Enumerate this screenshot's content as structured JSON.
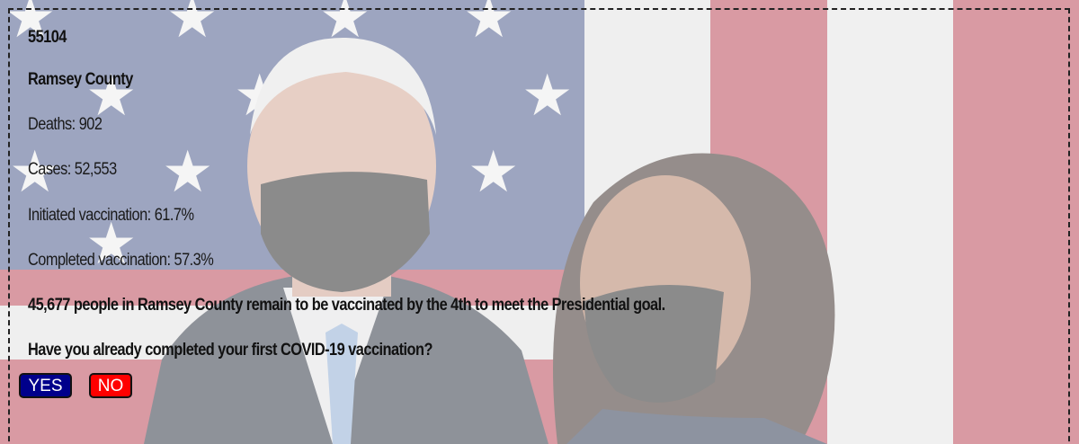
{
  "location": {
    "zip": "55104",
    "county": "Ramsey County"
  },
  "stats": {
    "deaths": "Deaths: 902",
    "cases": "Cases: 52,553",
    "initiated": "Initiated vaccination: 61.7%",
    "completed": "Completed vaccination: 57.3%"
  },
  "message": "45,677 people in Ramsey County remain to be vaccinated by the 4th to meet the Presidential goal.",
  "question": "Have you already completed your first COVID-19 vaccination?",
  "buttons": {
    "yes_label": "YES",
    "no_label": "NO"
  },
  "colors": {
    "yes_button": "#00008b",
    "no_button": "#ff0000",
    "flag_blue": "#3c4f8a",
    "flag_red": "#c0354a"
  }
}
